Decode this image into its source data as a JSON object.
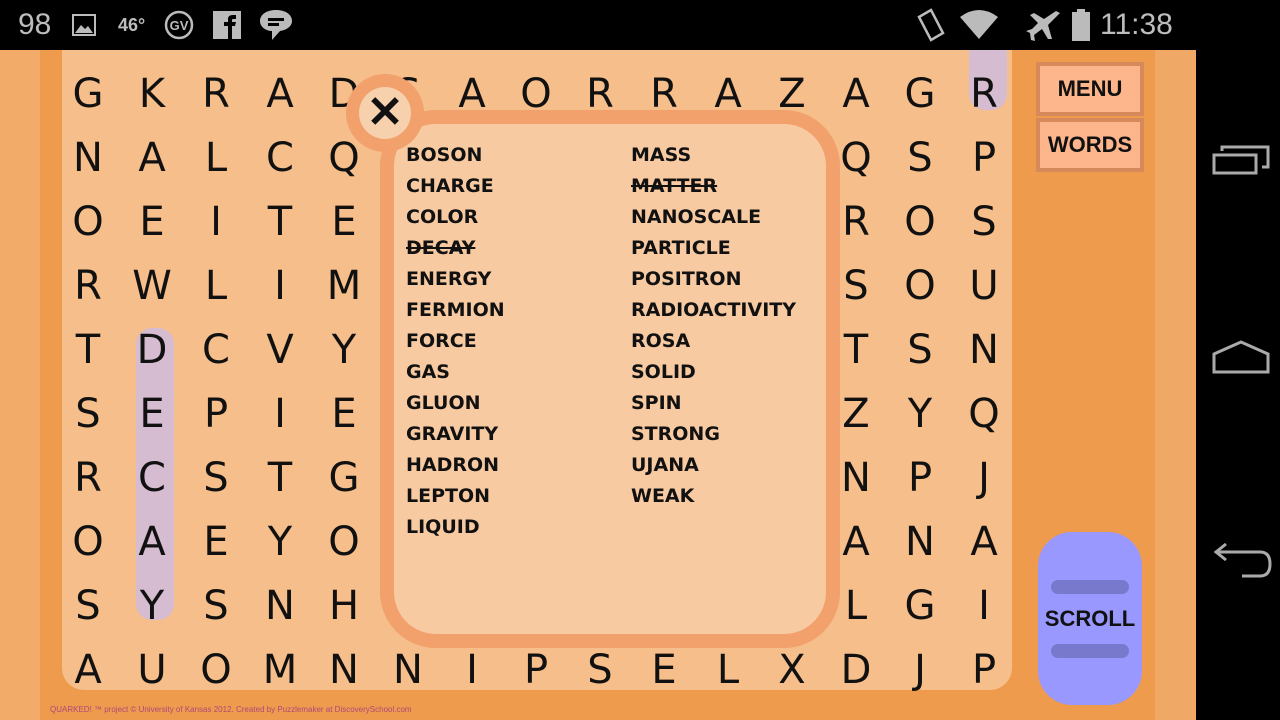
{
  "status_bar": {
    "battery_level": "98",
    "temperature": "46°",
    "time": "11:38",
    "left_icons": [
      "image-icon",
      "gv-icon",
      "facebook-icon",
      "chat-icon"
    ],
    "right_icons": [
      "vibrate-icon",
      "wifi-icon",
      "airplane-icon",
      "battery-icon"
    ]
  },
  "grid": [
    [
      "G",
      "K",
      "R",
      "A",
      "D",
      "S",
      "A",
      "O",
      "R",
      "R",
      "A",
      "Z",
      "A",
      "G",
      "R"
    ],
    [
      "N",
      "A",
      "L",
      "C",
      "Q",
      "",
      "",
      "",
      "",
      "",
      "",
      "",
      "Q",
      "S",
      "P"
    ],
    [
      "O",
      "E",
      "I",
      "T",
      "E",
      "",
      "",
      "",
      "",
      "",
      "",
      "",
      "R",
      "O",
      "S"
    ],
    [
      "R",
      "W",
      "L",
      "I",
      "M",
      "",
      "",
      "",
      "",
      "",
      "",
      "",
      "S",
      "O",
      "U"
    ],
    [
      "T",
      "D",
      "C",
      "V",
      "Y",
      "",
      "",
      "",
      "",
      "",
      "",
      "",
      "T",
      "S",
      "N"
    ],
    [
      "S",
      "E",
      "P",
      "I",
      "E",
      "",
      "",
      "",
      "",
      "",
      "",
      "",
      "Z",
      "Y",
      "Q"
    ],
    [
      "R",
      "C",
      "S",
      "T",
      "G",
      "",
      "",
      "",
      "",
      "",
      "",
      "",
      "N",
      "P",
      "J"
    ],
    [
      "O",
      "A",
      "E",
      "Y",
      "O",
      "",
      "",
      "",
      "",
      "",
      "",
      "",
      "A",
      "N",
      "A"
    ],
    [
      "S",
      "Y",
      "S",
      "N",
      "H",
      "",
      "",
      "",
      "",
      "",
      "",
      "",
      "L",
      "G",
      "I"
    ],
    [
      "A",
      "U",
      "O",
      "M",
      "N",
      "N",
      "I",
      "P",
      "S",
      "E",
      "L",
      "X",
      "D",
      "J",
      "P"
    ]
  ],
  "highlight_color": "#d6bcd0",
  "menu": {
    "menu_label": "MENU",
    "words_label": "WORDS",
    "scroll_label": "SCROLL"
  },
  "word_list": {
    "column1": [
      {
        "word": "BOSON",
        "found": false
      },
      {
        "word": "CHARGE",
        "found": false
      },
      {
        "word": "COLOR",
        "found": false
      },
      {
        "word": "DECAY",
        "found": true
      },
      {
        "word": "ENERGY",
        "found": false
      },
      {
        "word": "FERMION",
        "found": false
      },
      {
        "word": "FORCE",
        "found": false
      },
      {
        "word": "GAS",
        "found": false
      },
      {
        "word": "GLUON",
        "found": false
      },
      {
        "word": "GRAVITY",
        "found": false
      },
      {
        "word": "HADRON",
        "found": false
      },
      {
        "word": "LEPTON",
        "found": false
      },
      {
        "word": "LIQUID",
        "found": false
      }
    ],
    "column2": [
      {
        "word": "MASS",
        "found": false
      },
      {
        "word": "MATTER",
        "found": true
      },
      {
        "word": "NANOSCALE",
        "found": false
      },
      {
        "word": "PARTICLE",
        "found": false
      },
      {
        "word": "POSITRON",
        "found": false
      },
      {
        "word": "RADIOACTIVITY",
        "found": false
      },
      {
        "word": "ROSA",
        "found": false
      },
      {
        "word": "SOLID",
        "found": false
      },
      {
        "word": "SPIN",
        "found": false
      },
      {
        "word": "STRONG",
        "found": false
      },
      {
        "word": "UJANA",
        "found": false
      },
      {
        "word": "WEAK",
        "found": false
      }
    ]
  },
  "close_symbol": "✕",
  "footer": "QUARKED! ™ project © University of Kansas 2012. Created by Puzzlemaker at DiscoverySchool.com"
}
